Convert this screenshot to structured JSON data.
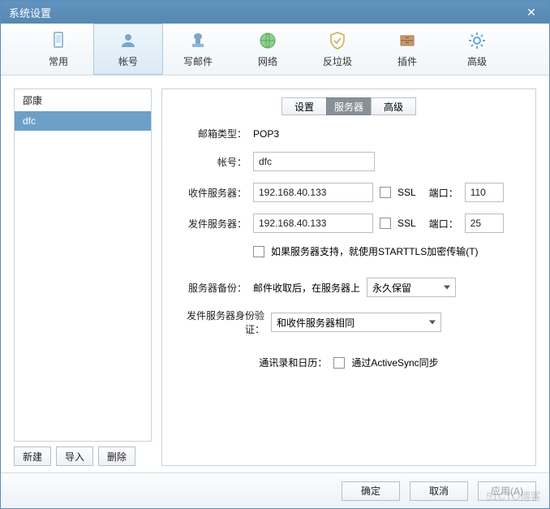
{
  "title": "系统设置",
  "toolbar": {
    "items": [
      {
        "label": "常用"
      },
      {
        "label": "帐号"
      },
      {
        "label": "写邮件"
      },
      {
        "label": "网络"
      },
      {
        "label": "反垃圾"
      },
      {
        "label": "插件"
      },
      {
        "label": "高级"
      }
    ]
  },
  "sidebar": {
    "accounts": [
      "邵康",
      "dfc"
    ],
    "buttons": {
      "new": "新建",
      "import": "导入",
      "delete": "删除"
    }
  },
  "tabs": {
    "settings": "设置",
    "server": "服务器",
    "advanced": "高级"
  },
  "form": {
    "mailbox_type_label": "邮箱类型：",
    "mailbox_type_value": "POP3",
    "account_label": "帐号：",
    "account_value": "dfc",
    "recv_label": "收件服务器：",
    "recv_value": "192.168.40.133",
    "ssl_label": "SSL",
    "port_label": "端口：",
    "recv_port": "110",
    "send_label": "发件服务器：",
    "send_value": "192.168.40.133",
    "send_port": "25",
    "starttls_label": "如果服务器支持，就使用STARTTLS加密传输(T)",
    "backup_label": "服务器备份：",
    "backup_text": "邮件收取后，在服务器上",
    "backup_select": "永久保留",
    "auth_label": "发件服务器身份验证：",
    "auth_select": "和收件服务器相同",
    "contacts_label": "通讯录和日历：",
    "activesync_label": "通过ActiveSync同步"
  },
  "footer": {
    "ok": "确定",
    "cancel": "取消",
    "apply": "应用(A)"
  },
  "watermark": "51CTO博客"
}
